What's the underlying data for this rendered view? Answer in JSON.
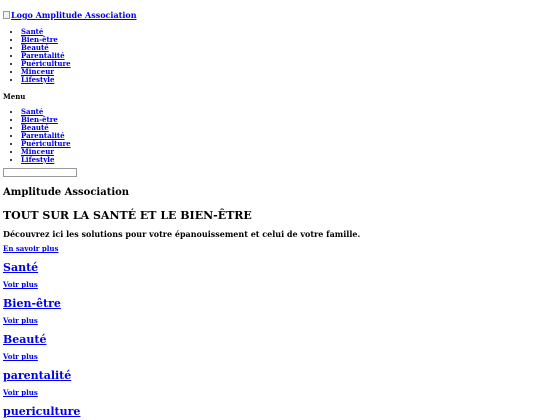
{
  "header": {
    "logo_alt": "Logo Amplitude Association",
    "nav": [
      "Santé",
      "Bien-être",
      "Beauté",
      "Parentalité",
      "Puériculture",
      "Minceur",
      "Lifestyle"
    ]
  },
  "menu": {
    "title": "Menu",
    "items": [
      "Santé",
      "Bien-être",
      "Beauté",
      "Parentalité",
      "Puériculture",
      "Minceur",
      "Lifestyle"
    ]
  },
  "hero": {
    "site_title": "Amplitude Association",
    "tagline": "TOUT SUR LA SANTÉ ET LE BIEN-ÊTRE",
    "intro": "Découvrez ici les solutions pour votre épanouissement et celui de votre famille.",
    "cta": "En savoir plus"
  },
  "categories": [
    {
      "title": "Santé",
      "link": "Voir plus"
    },
    {
      "title": "Bien-être",
      "link": "Voir plus"
    },
    {
      "title": "Beauté",
      "link": "Voir plus"
    },
    {
      "title": "parentalité",
      "link": "Voir plus"
    },
    {
      "title": "puericulture",
      "link": ""
    }
  ]
}
